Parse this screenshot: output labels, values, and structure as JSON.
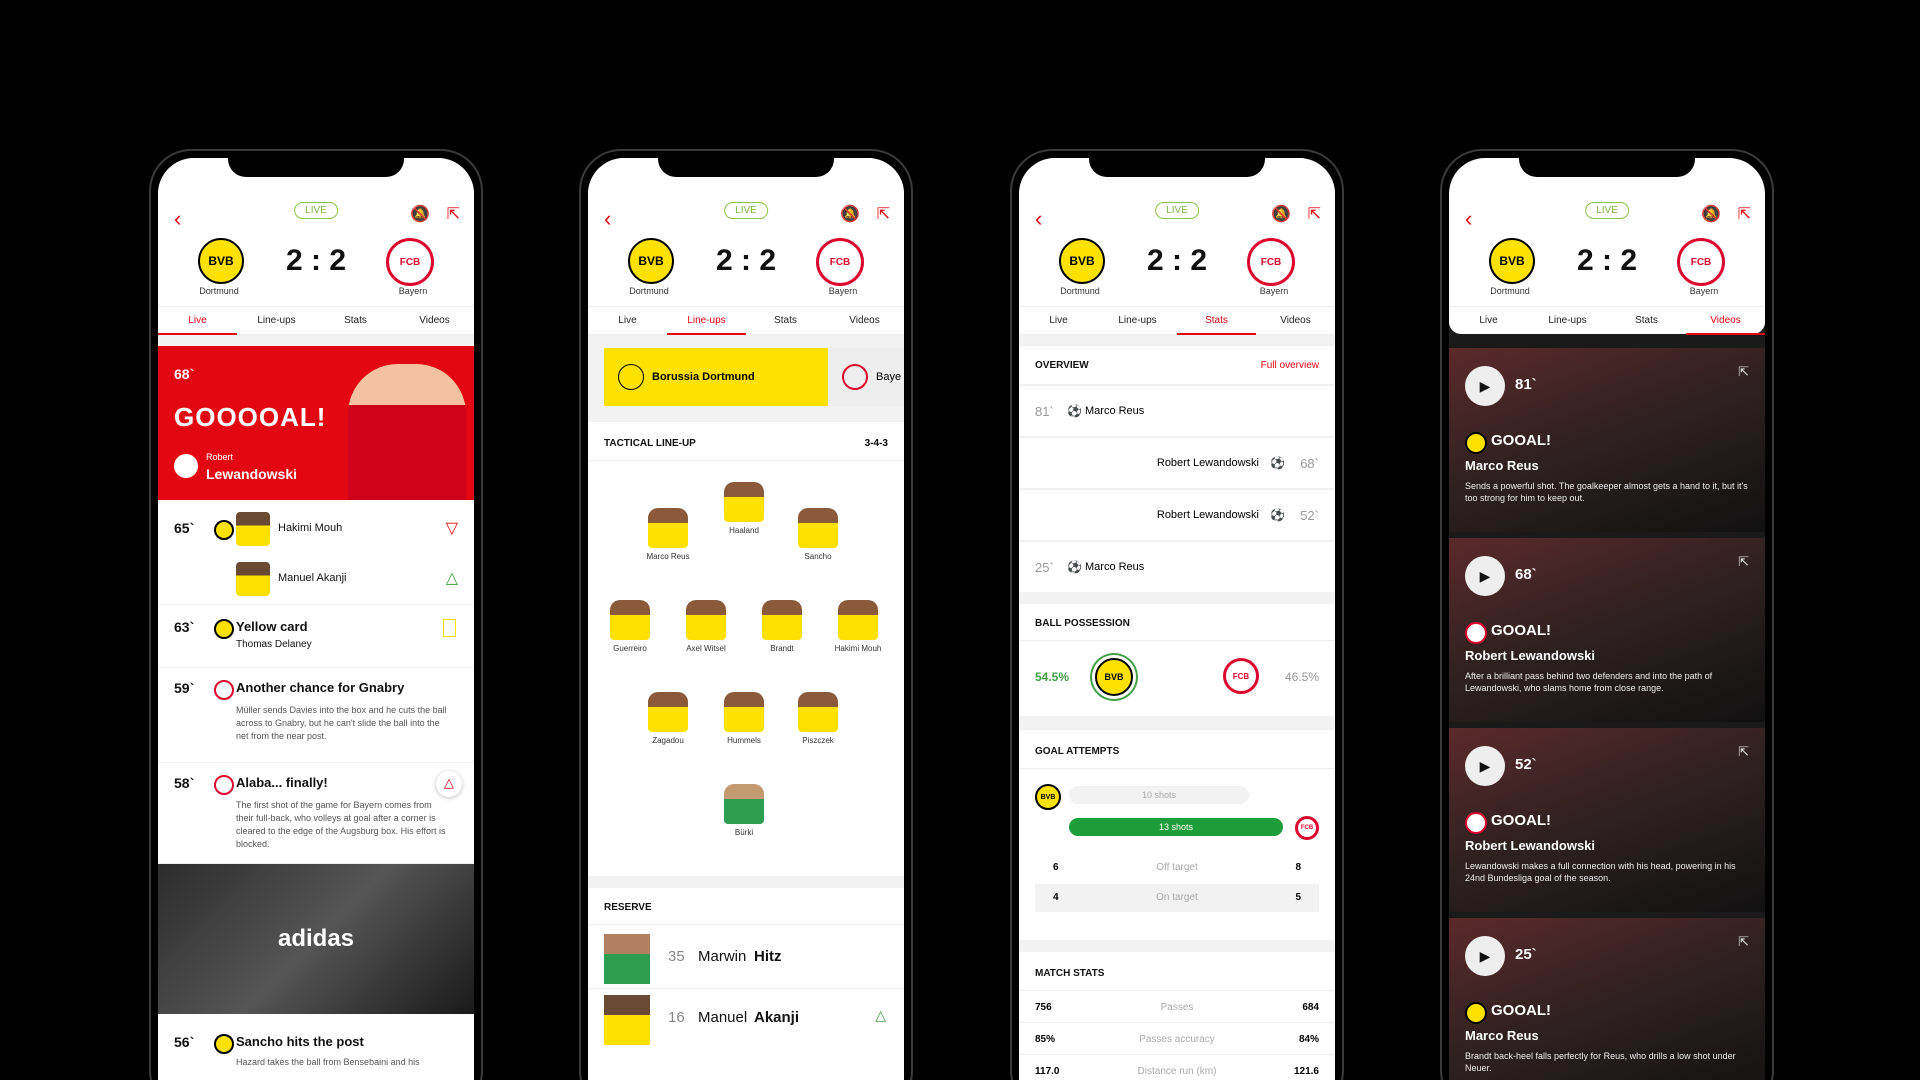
{
  "common": {
    "live": "LIVE",
    "home": "Dortmund",
    "away": "Bayern",
    "home_short": "BVB",
    "away_short": "FCB",
    "score": "2 : 2",
    "tabs": [
      "Live",
      "Line-ups",
      "Stats",
      "Videos"
    ]
  },
  "phone1": {
    "goal": {
      "minute": "68`",
      "title": "GOOOOAL!",
      "first": "Robert",
      "last": "Lewandowski"
    },
    "events": [
      {
        "minute": "65`",
        "player_out": "Hakimi Mouh",
        "player_in": "Manuel Akanji"
      },
      {
        "minute": "63`",
        "title": "Yellow card",
        "sub": "Thomas Delaney"
      },
      {
        "minute": "59`",
        "title": "Another chance for Gnabry",
        "text": "Müller sends Davies into the box and he cuts the ball across to Gnabry, but he can't slide the ball into the net from the near post."
      },
      {
        "minute": "58`",
        "title": "Alaba... finally!",
        "text": "The first shot of the game for Bayern comes from their full-back, who volleys at goal after a corner is cleared to the edge of the Augsburg box. His effort is blocked."
      },
      {
        "minute": "56`",
        "title": "Sancho hits the post",
        "text": "Hazard takes the ball from Bensebaini and his"
      }
    ],
    "ad": "adidas"
  },
  "phone2": {
    "team_home": "Borussia Dortmund",
    "team_away": "Baye",
    "tactical": "TACTICAL LINE-UP",
    "formation": "3-4-3",
    "players": [
      "Haaland",
      "Marco Reus",
      "Sancho",
      "Guerreiro",
      "Axel Witsel",
      "Brandt",
      "Hakimi Mouh",
      "Zagadou",
      "Hummels",
      "Piszczek",
      "Bürki"
    ],
    "reserve": "RESERVE",
    "reserves": [
      {
        "number": "35",
        "first": "Marwin",
        "last": "Hitz"
      },
      {
        "number": "16",
        "first": "Manuel",
        "last": "Akanji"
      }
    ]
  },
  "phone3": {
    "overview": "OVERVIEW",
    "full": "Full overview",
    "goals": [
      {
        "minute": "81`",
        "player": "Marco Reus"
      },
      {
        "minute": "68`",
        "player": "Robert Lewandowski"
      },
      {
        "minute": "52`",
        "player": "Robert Lewandowski"
      },
      {
        "minute": "25`",
        "player": "Marco Reus"
      }
    ],
    "possession_title": "BALL POSSESSION",
    "possession_home": "54.5%",
    "possession_away": "46.5%",
    "attempts_title": "GOAL ATTEMPTS",
    "shots_home": "10 shots",
    "shots_away": "13 shots",
    "attempt_rows": [
      {
        "home": "6",
        "label": "Off target",
        "away": "8"
      },
      {
        "home": "4",
        "label": "On target",
        "away": "5"
      }
    ],
    "match_stats_title": "MATCH STATS",
    "match_stats": [
      {
        "home": "756",
        "label": "Passes",
        "away": "684"
      },
      {
        "home": "85%",
        "label": "Passes accuracy",
        "away": "84%"
      },
      {
        "home": "117.0",
        "label": "Distance run (km)",
        "away": "121.6"
      }
    ]
  },
  "phone4": {
    "videos": [
      {
        "minute": "81`",
        "goal": "GOOAL!",
        "player": "Marco Reus",
        "desc": "Sends a powerful shot. The goalkeeper almost gets a hand to it, but it's too strong for him to keep out.",
        "team": "bvb"
      },
      {
        "minute": "68`",
        "goal": "GOOAL!",
        "player": "Robert Lewandowski",
        "desc": "After a brilliant pass behind two defenders and into the path of Lewandowski, who slams home from close range.",
        "team": "fcb"
      },
      {
        "minute": "52`",
        "goal": "GOOAL!",
        "player": "Robert Lewandowski",
        "desc": "Lewandowski makes a full connection with his head, powering in his 24nd Bundesliga goal of the season.",
        "team": "fcb"
      },
      {
        "minute": "25`",
        "goal": "GOOAL!",
        "player": "Marco Reus",
        "desc": "Brandt back-heel falls perfectly for Reus, who drills a low shot under Neuer.",
        "team": "bvb"
      }
    ]
  }
}
